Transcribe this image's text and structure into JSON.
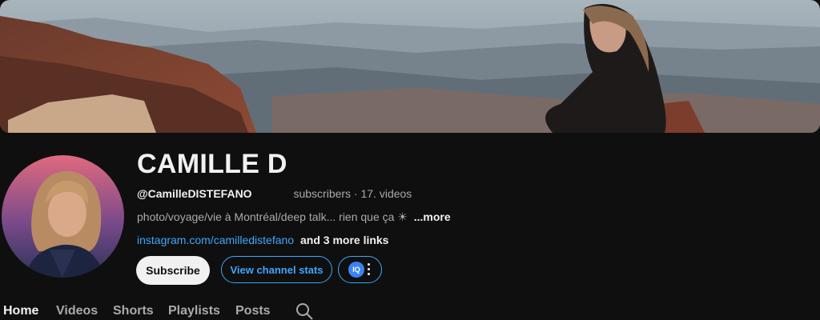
{
  "channel": {
    "name": "CAMILLE D",
    "handle": "@CamilleDISTEFANO",
    "stats": "subscribers · 17. videos",
    "description": "photo/voyage/vie à Montréal/deep talk... rien que ça ☀",
    "more_label": "...more",
    "link": "instagram.com/camilledistefano",
    "more_links": "and 3 more links"
  },
  "actions": {
    "subscribe_label": "Subscribe",
    "stats_label": "View channel stats",
    "extension_badge": "IQ"
  },
  "tabs": [
    {
      "label": "Home",
      "active": true
    },
    {
      "label": "Videos",
      "active": false
    },
    {
      "label": "Shorts",
      "active": false
    },
    {
      "label": "Playlists",
      "active": false
    },
    {
      "label": "Posts",
      "active": false
    }
  ],
  "icons": {
    "search": "search-icon",
    "more": "more-vertical-icon"
  },
  "colors": {
    "background": "#0f0f0f",
    "text": "#f1f1f1",
    "muted": "#aaaaaa",
    "accent_blue": "#3ea6ff",
    "subscribe_bg": "#f1f1f1"
  }
}
